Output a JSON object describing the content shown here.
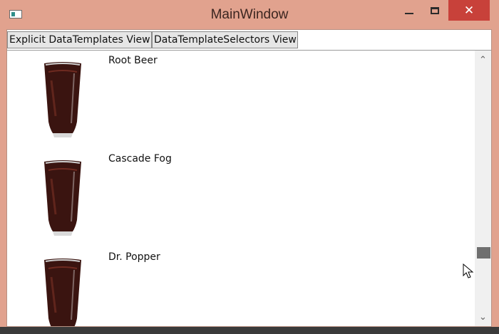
{
  "window": {
    "title": "MainWindow",
    "close_glyph": "✕"
  },
  "tabs": [
    {
      "label": "Explicit DataTemplates View"
    },
    {
      "label": "DataTemplateSelectors View"
    }
  ],
  "items": [
    {
      "name": "Root Beer",
      "icon": "soda-glass-icon"
    },
    {
      "name": "Cascade Fog",
      "icon": "soda-glass-icon"
    },
    {
      "name": "Dr. Popper",
      "icon": "soda-glass-icon"
    }
  ],
  "scrollbar": {
    "up_glyph": "⌃",
    "down_glyph": "⌄",
    "position": 0.78
  },
  "colors": {
    "frame": "#e1a28e",
    "close": "#c8413a",
    "drink": "#3a1410"
  }
}
